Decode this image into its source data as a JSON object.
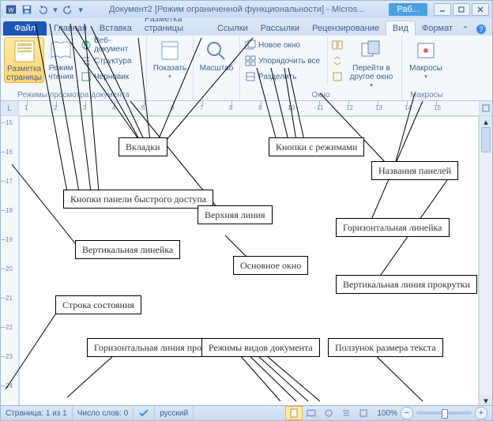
{
  "title": "Документ2 [Режим ограниченной функциональности] - Micros...",
  "context_tab": "Раб...",
  "qat_icons": [
    "word-icon",
    "save-icon",
    "undo-icon",
    "redo-icon"
  ],
  "tabs": {
    "file": "Файл",
    "items": [
      "Главная",
      "Вставка",
      "Разметка страницы",
      "Ссылки",
      "Рассылки",
      "Рецензирование",
      "Вид",
      "Формат"
    ],
    "active": "Вид"
  },
  "ribbon": {
    "views_group": {
      "label": "Режимы просмотра документа",
      "page_layout": "Разметка страницы",
      "reading": "Режим чтения",
      "web": "Веб-документ",
      "outline": "Структура",
      "draft": "Черновик"
    },
    "show_group": {
      "btn": "Показать"
    },
    "zoom_group": {
      "btn": "Масштаб"
    },
    "window_group": {
      "label": "Окно",
      "new_window": "Новое окно",
      "arrange": "Упорядочить все",
      "split": "Разделить",
      "switch": "Перейти в другое окно"
    },
    "macros_group": {
      "label": "Макросы",
      "btn": "Макросы"
    }
  },
  "annotations": {
    "tabs": "Вкладки",
    "qat": "Кнопки панели быстрого доступа",
    "modes": "Кнопки с режимами",
    "panels": "Названия панелей",
    "top_line": "Верхняя линия",
    "vruler": "Вертикальная линейка",
    "hruler": "Горизонтальная линейка",
    "main": "Основное окно",
    "vscroll": "Вертикальная линия прокрутки",
    "status": "Строка состояния",
    "hscroll": "Горизонтальная линия прокрутки",
    "viewmodes": "Режимы видов документа",
    "zoom": "Ползунок размера текста"
  },
  "ruler_h": [
    1,
    2,
    3,
    4,
    5,
    6,
    7,
    8,
    9,
    10,
    11,
    12,
    13,
    14,
    15
  ],
  "ruler_v": [
    15,
    16,
    17,
    18,
    19,
    20,
    21,
    22,
    23,
    24
  ],
  "status_bar": {
    "page": "Страница: 1 из 1",
    "words": "Число слов: 0",
    "lang": "русский",
    "zoom": "100%"
  }
}
